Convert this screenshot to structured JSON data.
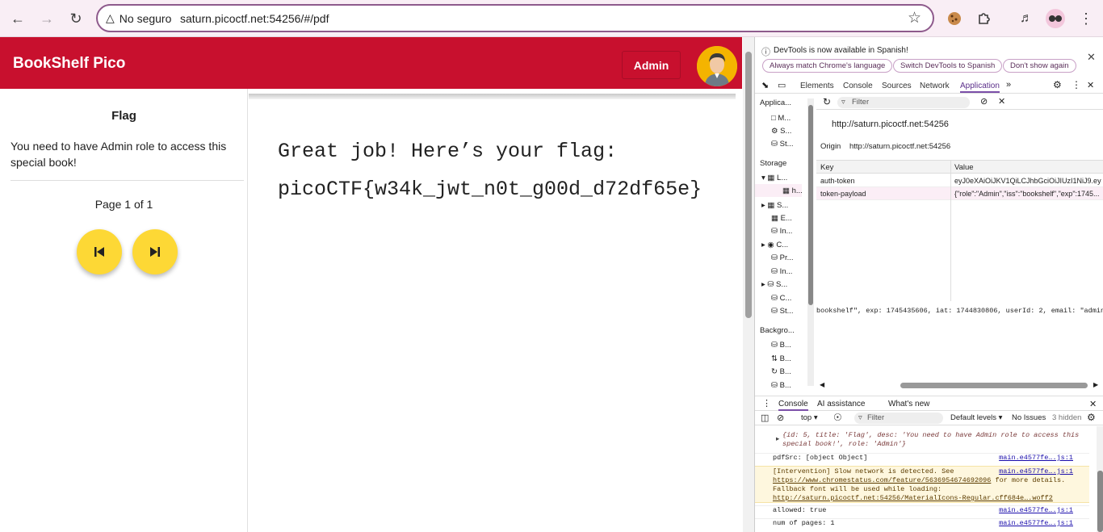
{
  "browser": {
    "security_label": "No seguro",
    "url": "saturn.picoctf.net:54256/#/pdf"
  },
  "app": {
    "title": "BookShelf Pico",
    "admin_button": "Admin",
    "accent_color": "#c8102e",
    "fab_color": "#fdd835"
  },
  "sidebar": {
    "title": "Flag",
    "description": "You need to have Admin role to access this special book!",
    "page_info": "Page 1 of 1"
  },
  "content": {
    "line1": "Great job! Here’s your flag:",
    "line2": "picoCTF{w34k_jwt_n0t_g00d_d72df65e}"
  },
  "devtools": {
    "info_text": "DevTools is now available in Spanish!",
    "info_buttons": [
      "Always match Chrome's language",
      "Switch DevTools to Spanish",
      "Don't show again"
    ],
    "tabs": [
      "Elements",
      "Console",
      "Sources",
      "Network",
      "Application"
    ],
    "active_tab": "Application",
    "tree": {
      "section_app": "Applica...",
      "app_items": [
        "M...",
        "S...",
        "St..."
      ],
      "section_storage": "Storage",
      "storage_items": [
        "L...",
        "h...",
        "S...",
        "E...",
        "In...",
        "C...",
        "Pr...",
        "In...",
        "S...",
        "C...",
        "St..."
      ],
      "section_bg": "Backgro...",
      "bg_items": [
        "B...",
        "B...",
        "B...",
        "B..."
      ]
    },
    "filter_placeholder": "Filter",
    "origin_big": "http://saturn.picoctf.net:54256",
    "origin_label": "Origin",
    "origin_value": "http://saturn.picoctf.net:54256",
    "table": {
      "headers": [
        "Key",
        "Value"
      ],
      "rows": [
        {
          "key": "auth-token",
          "value": "eyJ0eXAiOiJKV1QiLCJhbGciOiJIUzI1NiJ9.eyJ..."
        },
        {
          "key": "token-payload",
          "value": "{\"role\":\"Admin\",\"iss\":\"bookshelf\",\"exp\":1745..."
        }
      ]
    },
    "preview": "bookshelf\", exp: 1745435606, iat: 1744830806, userId: 2, email: \"admin\"}",
    "drawer_tabs": [
      "Console",
      "AI assistance",
      "What's new"
    ],
    "console_toolbar": {
      "context": "top",
      "filter": "Filter",
      "levels": "Default levels",
      "issues": "No Issues",
      "hidden": "3 hidden"
    },
    "console": [
      {
        "text": "{id: 5, title: 'Flag', desc: 'You need to have Admin role to access this special book!', role: 'Admin'}",
        "src": ""
      },
      {
        "text": "pdfSrc: [object Object]",
        "src": "main.e4577fe….js:1"
      },
      {
        "text": "[Intervention] Slow network is detected. See",
        "link1": "https://www.chromestatus.com/feature/5636954674692096",
        "text2": "for more details. Fallback font will be used while loading:",
        "link2": "http://saturn.picoctf.net:54256/MaterialIcons-Regular.cff684e….woff2",
        "src": "main.e4577fe….js:1"
      },
      {
        "text": "allowed: true",
        "src": "main.e4577fe….js:1"
      },
      {
        "text": "num of pages: 1",
        "src": "main.e4577fe….js:1"
      }
    ]
  }
}
